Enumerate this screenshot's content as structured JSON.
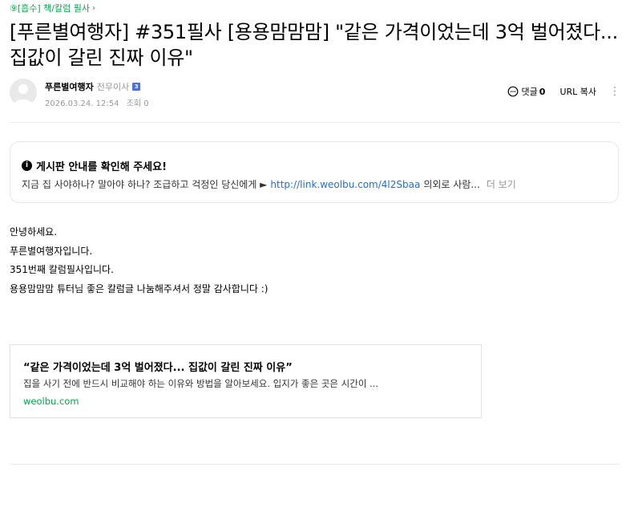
{
  "breadcrumb": {
    "label": "⑨[흡수] 책/칼럼 필사",
    "color": "#03a64a"
  },
  "post": {
    "title": "[푸른별여행자] #351필사 [용용맘맘맘] \"같은 가격이었는데 3억 벌어졌다... 집값이 갈린 진짜 이유\""
  },
  "author": {
    "name": "푸른별여행자",
    "rank": "전무이사",
    "rank_badge": "3",
    "date": "2026.03.24. 12:54",
    "views": "조회 0"
  },
  "tools": {
    "comment_label": "댓글",
    "comment_count": "0",
    "url_copy": "URL 복사",
    "more": "⋮"
  },
  "notice": {
    "title": "게시판 안내를 확인해 주세요!",
    "body_prefix": "지금 집 사야하나? 말아야 하나? 조급하고 걱정인 당신에게 ►",
    "link": "http://link.weolbu.com/4l2Sbaa",
    "body_suffix": "의외로 사람...",
    "more": "더 보기"
  },
  "body": {
    "lines": [
      "안녕하세요.",
      "푸른별여행자입니다.",
      "351번째 칼럼필사입니다.",
      "용용맘맘맘 튜터님 좋은 칼럼글 나눔해주셔서 정말 감사합니다 :)"
    ]
  },
  "link_card": {
    "title": "“같은 가격이었는데 3억 벌어졌다... 집값이 갈린 진짜 이유”",
    "description": "집을 사기 전에 반드시 비교해야 하는 이유와 방법을 알아보세요. 입지가 좋은 곳은 시간이 ...",
    "domain": "weolbu.com"
  },
  "colors": {
    "accent_green": "#03a64a",
    "link_blue": "#1e6ed6",
    "muted_gray": "#979797"
  }
}
